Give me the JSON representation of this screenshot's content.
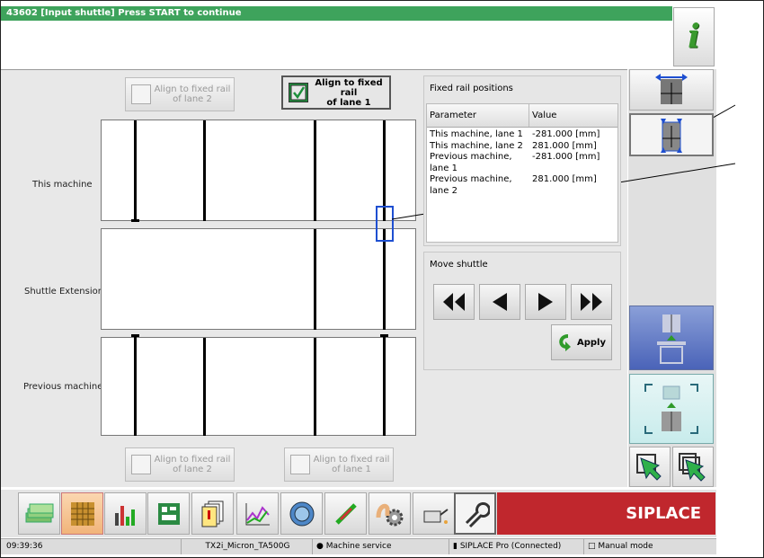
{
  "title_bar": {
    "message": "43602 [Input shuttle] Press START to continue"
  },
  "info_button": {
    "glyph": "i"
  },
  "align_top": {
    "lane2_label_l1": "Align to fixed rail",
    "lane2_label_l2": "of lane 2",
    "lane1_label_l1": "Align to fixed rail",
    "lane1_label_l2": "of lane 1"
  },
  "align_bottom": {
    "lane2_label_l1": "Align to fixed rail",
    "lane2_label_l2": "of lane 2",
    "lane1_label_l1": "Align to fixed rail",
    "lane1_label_l2": "of lane 1"
  },
  "rows": {
    "this_machine": "This machine",
    "shuttle_extension": "Shuttle Extension",
    "previous_machine": "Previous machine"
  },
  "fixed_rail": {
    "title": "Fixed rail positions",
    "col_parameter": "Parameter",
    "col_value": "Value",
    "rows": [
      {
        "param": "This machine, lane 1",
        "value": "-281.000 [mm]"
      },
      {
        "param": "This machine, lane 2",
        "value": "281.000 [mm]"
      },
      {
        "param": "Previous machine, lane 1",
        "value": "-281.000 [mm]"
      },
      {
        "param": "Previous machine, lane 2",
        "value": "281.000 [mm]"
      }
    ]
  },
  "move_shuttle": {
    "title": "Move shuttle",
    "apply_label": "Apply"
  },
  "brand": {
    "name": "SIPLACE",
    "color": "#c0272d",
    "accent": "#3ea35c"
  },
  "status": {
    "time": "09:39:36",
    "machine": "TX2i_Micron_TA500G",
    "mode_service": "Machine service",
    "connection": "SIPLACE Pro (Connected)",
    "manual": "Manual mode"
  },
  "taskbar_icons": [
    "money-stack-icon",
    "grid-layout-icon",
    "bar-chart-icon",
    "board-layout-icon",
    "documents-icon",
    "trend-chart-icon",
    "camera-lens-icon",
    "tools-icon",
    "gear-hand-icon",
    "oil-can-icon",
    "wrench-icon"
  ]
}
